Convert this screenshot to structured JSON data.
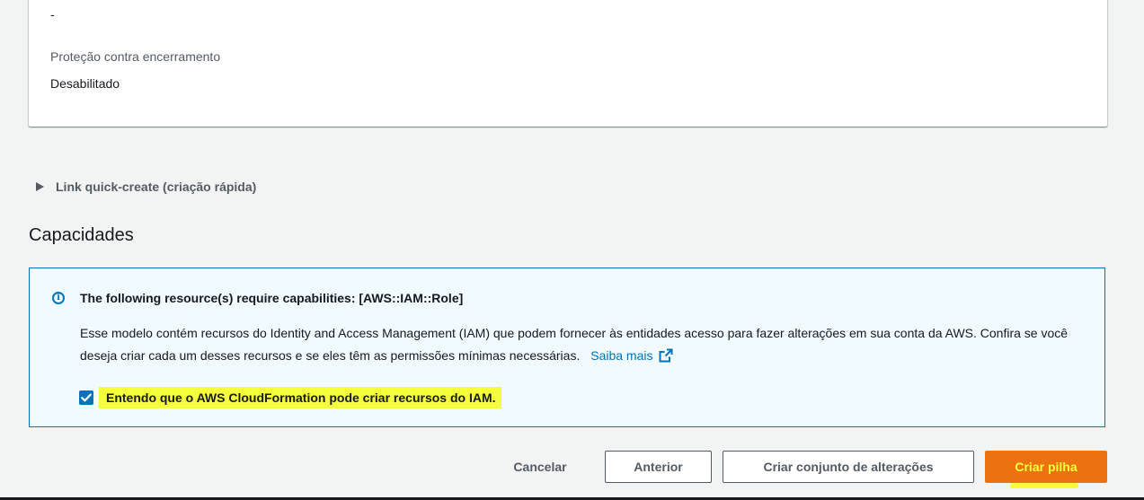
{
  "details_card": {
    "empty_value": "-",
    "termination_protection_label": "Proteção contra encerramento",
    "termination_protection_value": "Desabilitado"
  },
  "quick_create": {
    "label": "Link quick-create (criação rápida)"
  },
  "capabilities": {
    "title": "Capacidades",
    "alert": {
      "icon": "info-icon",
      "title": "The following resource(s) require capabilities: [AWS::IAM::Role]",
      "body": "Esse modelo contém recursos do Identity and Access Management (IAM) que podem fornecer às entidades acesso para fazer alterações em sua conta da AWS. Confira se você deseja criar cada um desses recursos e se eles têm as permissões mínimas necessárias.",
      "learn_more": "Saiba mais",
      "acknowledge_label": "Entendo que o AWS CloudFormation pode criar recursos do IAM.",
      "acknowledge_checked": true
    }
  },
  "footer": {
    "cancel_label": "Cancelar",
    "previous_label": "Anterior",
    "create_changeset_label": "Criar conjunto de alterações",
    "create_stack_label": "Criar pilha"
  },
  "colors": {
    "accent": "#0073bb",
    "primary_button": "#ec7211",
    "highlight": "#f5ff3a",
    "alert_background": "#f1faff"
  }
}
